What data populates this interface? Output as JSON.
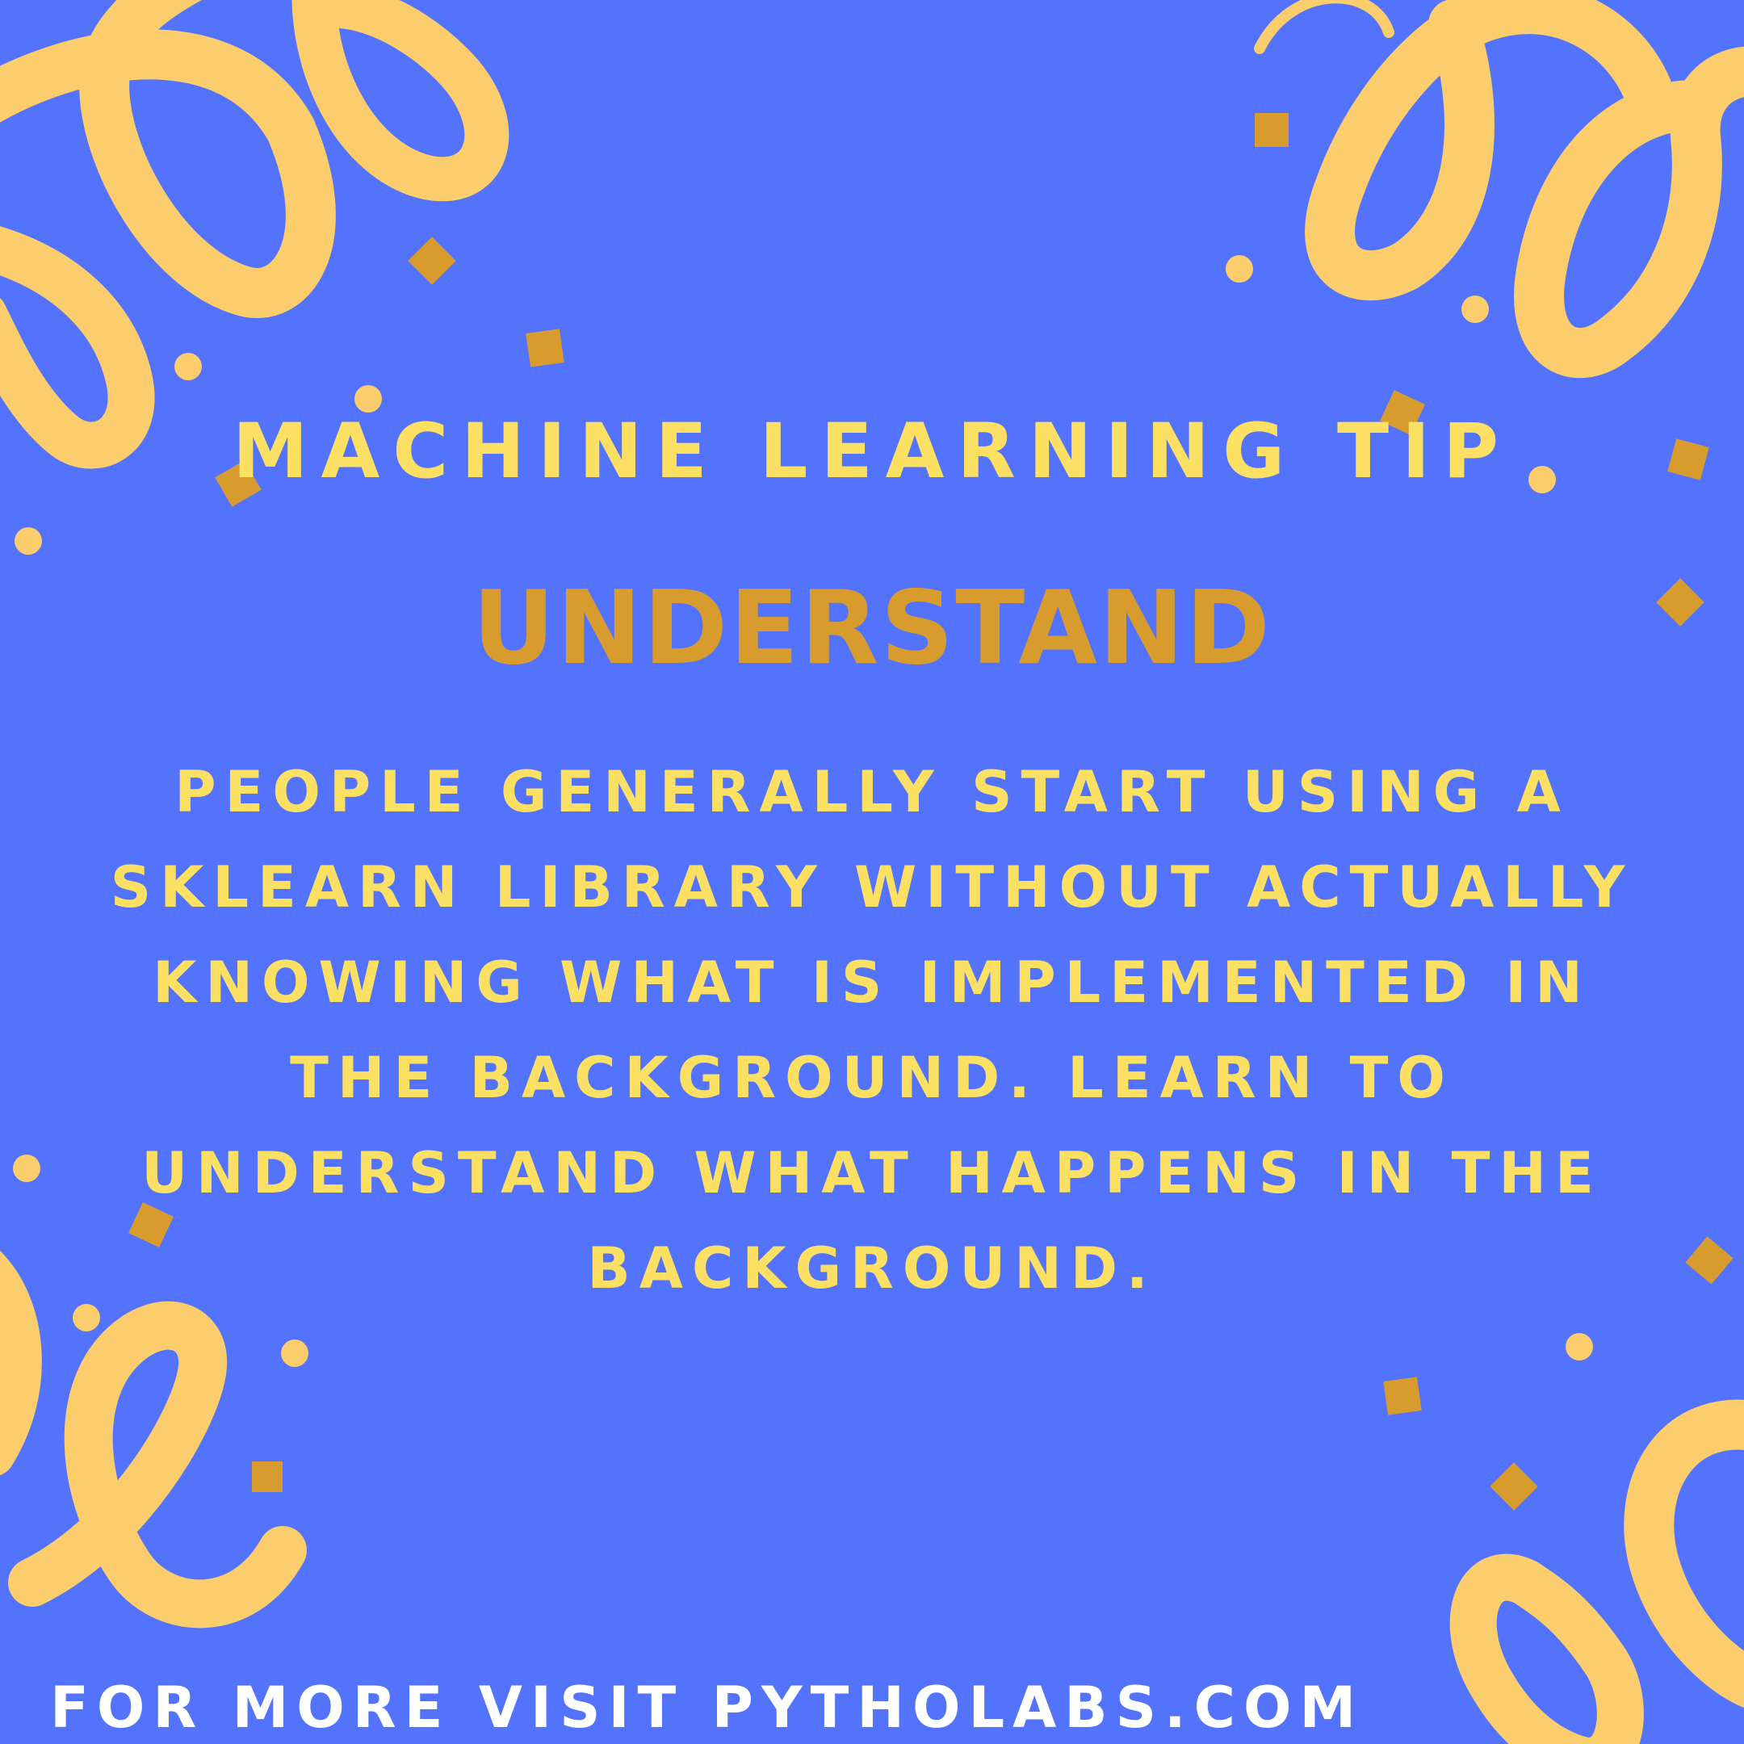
{
  "colors": {
    "background": "#5373FD",
    "heading_yellow": "#FBE064",
    "subtitle_gold": "#D89C2E",
    "streamer_yellow": "#FBCD6C",
    "confetti_gold": "#D89C2E",
    "streamer_shadow": "#B8964E",
    "footer_white": "#FFFFFF"
  },
  "poster": {
    "title": "MACHINE LEARNING TIP",
    "subtitle": "UNDERSTAND",
    "body_lines": [
      "PEOPLE GENERALLY START USING A",
      "SKLEARN LIBRARY WITHOUT ACTUALLY",
      "KNOWING WHAT IS IMPLEMENTED IN",
      "THE BACKGROUND. LEARN TO",
      "UNDERSTAND WHAT HAPPENS IN THE",
      "BACKGROUND."
    ],
    "footer": "FOR MORE VISIT PYTHOLABS.COM"
  },
  "decorations": {
    "streamer_icon": "confetti-streamer",
    "dot_icon": "confetti-dot",
    "square_icon": "confetti-square"
  }
}
